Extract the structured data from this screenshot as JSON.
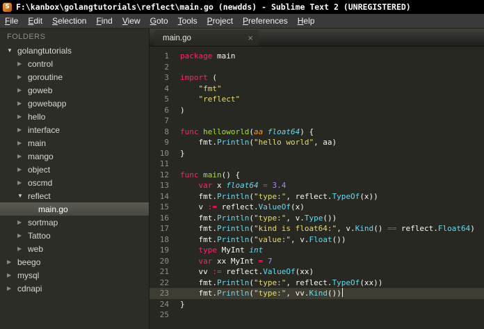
{
  "window": {
    "title": "F:\\kanbox\\golangtutorials\\reflect\\main.go (newdds) - Sublime Text 2 (UNREGISTERED)",
    "app_icon_letter": "S"
  },
  "menu_bar": {
    "items": [
      "File",
      "Edit",
      "Selection",
      "Find",
      "View",
      "Goto",
      "Tools",
      "Project",
      "Preferences",
      "Help"
    ]
  },
  "sidebar": {
    "header": "FOLDERS",
    "items": [
      {
        "label": "golangtutorials",
        "indent": 0,
        "type": "folder",
        "state": "expanded",
        "selected": false
      },
      {
        "label": "control",
        "indent": 1,
        "type": "folder",
        "state": "collapsed",
        "selected": false
      },
      {
        "label": "goroutine",
        "indent": 1,
        "type": "folder",
        "state": "collapsed",
        "selected": false
      },
      {
        "label": "goweb",
        "indent": 1,
        "type": "folder",
        "state": "collapsed",
        "selected": false
      },
      {
        "label": "gowebapp",
        "indent": 1,
        "type": "folder",
        "state": "collapsed",
        "selected": false
      },
      {
        "label": "hello",
        "indent": 1,
        "type": "folder",
        "state": "collapsed",
        "selected": false
      },
      {
        "label": "interface",
        "indent": 1,
        "type": "folder",
        "state": "collapsed",
        "selected": false
      },
      {
        "label": "main",
        "indent": 1,
        "type": "folder",
        "state": "collapsed",
        "selected": false
      },
      {
        "label": "mango",
        "indent": 1,
        "type": "folder",
        "state": "collapsed",
        "selected": false
      },
      {
        "label": "object",
        "indent": 1,
        "type": "folder",
        "state": "collapsed",
        "selected": false
      },
      {
        "label": "oscmd",
        "indent": 1,
        "type": "folder",
        "state": "collapsed",
        "selected": false
      },
      {
        "label": "reflect",
        "indent": 1,
        "type": "folder",
        "state": "expanded",
        "selected": false
      },
      {
        "label": "main.go",
        "indent": 2,
        "type": "file",
        "state": "none",
        "selected": true
      },
      {
        "label": "sortmap",
        "indent": 1,
        "type": "folder",
        "state": "collapsed",
        "selected": false
      },
      {
        "label": "Tattoo",
        "indent": 1,
        "type": "folder",
        "state": "collapsed",
        "selected": false
      },
      {
        "label": "web",
        "indent": 1,
        "type": "folder",
        "state": "collapsed",
        "selected": false
      },
      {
        "label": "beego",
        "indent": 0,
        "type": "folder",
        "state": "collapsed",
        "selected": false
      },
      {
        "label": "mysql",
        "indent": 0,
        "type": "folder",
        "state": "collapsed",
        "selected": false
      },
      {
        "label": "cdnapi",
        "indent": 0,
        "type": "folder",
        "state": "collapsed",
        "selected": false
      }
    ]
  },
  "editor": {
    "tab": {
      "label": "main.go",
      "close_glyph": "×"
    },
    "active_line": 23,
    "code_lines": [
      [
        [
          "kw",
          "package"
        ],
        [
          "pl",
          " main"
        ]
      ],
      [],
      [
        [
          "kw",
          "import"
        ],
        [
          "pl",
          " ("
        ]
      ],
      [
        [
          "pl",
          "    "
        ],
        [
          "str",
          "\"fmt\""
        ]
      ],
      [
        [
          "pl",
          "    "
        ],
        [
          "str",
          "\"reflect\""
        ]
      ],
      [
        [
          "pl",
          ")"
        ]
      ],
      [],
      [
        [
          "kw",
          "func"
        ],
        [
          "pl",
          " "
        ],
        [
          "fn",
          "helloworld"
        ],
        [
          "pl",
          "("
        ],
        [
          "par",
          "aa"
        ],
        [
          "pl",
          " "
        ],
        [
          "typ",
          "float64"
        ],
        [
          "pl",
          ") {"
        ]
      ],
      [
        [
          "pl",
          "    fmt."
        ],
        [
          "call",
          "Println"
        ],
        [
          "pl",
          "("
        ],
        [
          "str",
          "\"hello world\""
        ],
        [
          "pl",
          ", aa)"
        ]
      ],
      [
        [
          "pl",
          "}"
        ]
      ],
      [],
      [
        [
          "kw",
          "func"
        ],
        [
          "pl",
          " "
        ],
        [
          "fn",
          "main"
        ],
        [
          "pl",
          "() {"
        ]
      ],
      [
        [
          "pl",
          "    "
        ],
        [
          "kw",
          "var"
        ],
        [
          "pl",
          " x "
        ],
        [
          "typ",
          "float64"
        ],
        [
          "pl",
          " "
        ],
        [
          "op",
          "="
        ],
        [
          "pl",
          " "
        ],
        [
          "num",
          "3.4"
        ]
      ],
      [
        [
          "pl",
          "    fmt."
        ],
        [
          "call",
          "Println"
        ],
        [
          "pl",
          "("
        ],
        [
          "str",
          "\"type:\""
        ],
        [
          "pl",
          ", reflect."
        ],
        [
          "call",
          "TypeOf"
        ],
        [
          "pl",
          "(x))"
        ]
      ],
      [
        [
          "pl",
          "    v "
        ],
        [
          "op",
          ":="
        ],
        [
          "pl",
          " reflect."
        ],
        [
          "call",
          "ValueOf"
        ],
        [
          "pl",
          "(x)"
        ]
      ],
      [
        [
          "pl",
          "    fmt."
        ],
        [
          "call",
          "Println"
        ],
        [
          "pl",
          "("
        ],
        [
          "str",
          "\"type:\""
        ],
        [
          "pl",
          ", v."
        ],
        [
          "call",
          "Type"
        ],
        [
          "pl",
          "())"
        ]
      ],
      [
        [
          "pl",
          "    fmt."
        ],
        [
          "call",
          "Println"
        ],
        [
          "pl",
          "("
        ],
        [
          "str",
          "\"kind is float64:\""
        ],
        [
          "pl",
          ", v."
        ],
        [
          "call",
          "Kind"
        ],
        [
          "pl",
          "() "
        ],
        [
          "op",
          "=="
        ],
        [
          "pl",
          " reflect."
        ],
        [
          "call",
          "Float64"
        ],
        [
          "pl",
          ")"
        ]
      ],
      [
        [
          "pl",
          "    fmt."
        ],
        [
          "call",
          "Println"
        ],
        [
          "pl",
          "("
        ],
        [
          "str",
          "\"value:\""
        ],
        [
          "pl",
          ", v."
        ],
        [
          "call",
          "Float"
        ],
        [
          "pl",
          "())"
        ]
      ],
      [
        [
          "pl",
          "    "
        ],
        [
          "kw",
          "type"
        ],
        [
          "pl",
          " MyInt "
        ],
        [
          "typ",
          "int"
        ]
      ],
      [
        [
          "pl",
          "    "
        ],
        [
          "kw",
          "var"
        ],
        [
          "pl",
          " xx MyInt "
        ],
        [
          "op",
          "="
        ],
        [
          "pl",
          " "
        ],
        [
          "num",
          "7"
        ]
      ],
      [
        [
          "pl",
          "    vv "
        ],
        [
          "op",
          ":="
        ],
        [
          "pl",
          " reflect."
        ],
        [
          "call",
          "ValueOf"
        ],
        [
          "pl",
          "(xx)"
        ]
      ],
      [
        [
          "pl",
          "    fmt."
        ],
        [
          "call",
          "Println"
        ],
        [
          "pl",
          "("
        ],
        [
          "str",
          "\"type:\""
        ],
        [
          "pl",
          ", reflect."
        ],
        [
          "call",
          "TypeOf"
        ],
        [
          "pl",
          "(xx))"
        ]
      ],
      [
        [
          "pl",
          "    fmt."
        ],
        [
          "call",
          "Println"
        ],
        [
          "pl",
          "("
        ],
        [
          "str",
          "\"type:\""
        ],
        [
          "pl",
          ", vv."
        ],
        [
          "call",
          "Kind"
        ],
        [
          "pl",
          "())"
        ]
      ],
      [
        [
          "pl",
          "}"
        ]
      ],
      []
    ]
  },
  "theme": {
    "titlebar_bg": "#000000",
    "menubar_bg": "#3a3a3a",
    "sidebar_bg": "#2d2d28",
    "sidebar_selected": "#5a5a53",
    "tabbar_bg": "#1e1e1b",
    "tabbar_top": "#3f3f3a",
    "editor_bg": "#272822",
    "editor_fg": "#f8f8f2",
    "line_highlight": "#3e3d32",
    "gutter_fg": "#8f908a",
    "keyword": "#f92672",
    "string": "#e6db74",
    "type": "#66d9ef",
    "number": "#ae81ff",
    "function": "#a6e22e",
    "call": "#66d9ef",
    "param": "#fd971f"
  }
}
